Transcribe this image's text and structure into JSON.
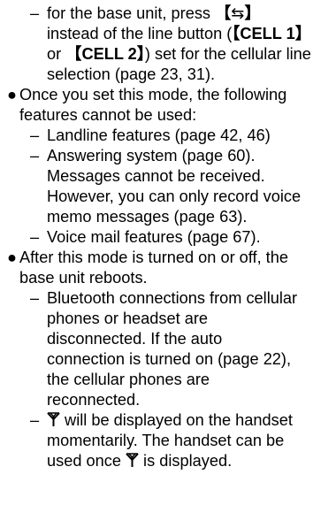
{
  "sections": [
    {
      "type": "dash",
      "lines": [
        "for the base unit, press ",
        "instead of the line button (",
        "or ",
        "selection (page 23, 31)."
      ],
      "key_left": "【",
      "key_icon": "⇆",
      "key_right": "】",
      "cell1": "CELL 1",
      "cell2": "CELL 2",
      "after_cell2": ") set for the cellular line"
    },
    {
      "type": "bullet",
      "lines": [
        "Once you set this mode, the following",
        "features cannot be used:"
      ],
      "items": [
        [
          "Landline features (page 42, 46)"
        ],
        [
          "Answering system (page 60).",
          "Messages cannot be received.",
          "However, you can only record voice",
          "memo messages (page 63)."
        ],
        [
          "Voice mail features (page 67)."
        ]
      ]
    },
    {
      "type": "bullet",
      "lines": [
        "After this mode is turned on or off, the",
        "base unit reboots."
      ],
      "items": [
        [
          "Bluetooth connections from cellular",
          "phones or headset are",
          "disconnected. If the auto",
          "connection is turned on (page 22),",
          "the cellular phones are",
          "reconnected."
        ],
        [
          " will be displayed on the handset",
          "momentarily. The handset can be",
          "used once ",
          " is displayed."
        ]
      ]
    }
  ],
  "bullet_char": "●",
  "dash_char": "–"
}
